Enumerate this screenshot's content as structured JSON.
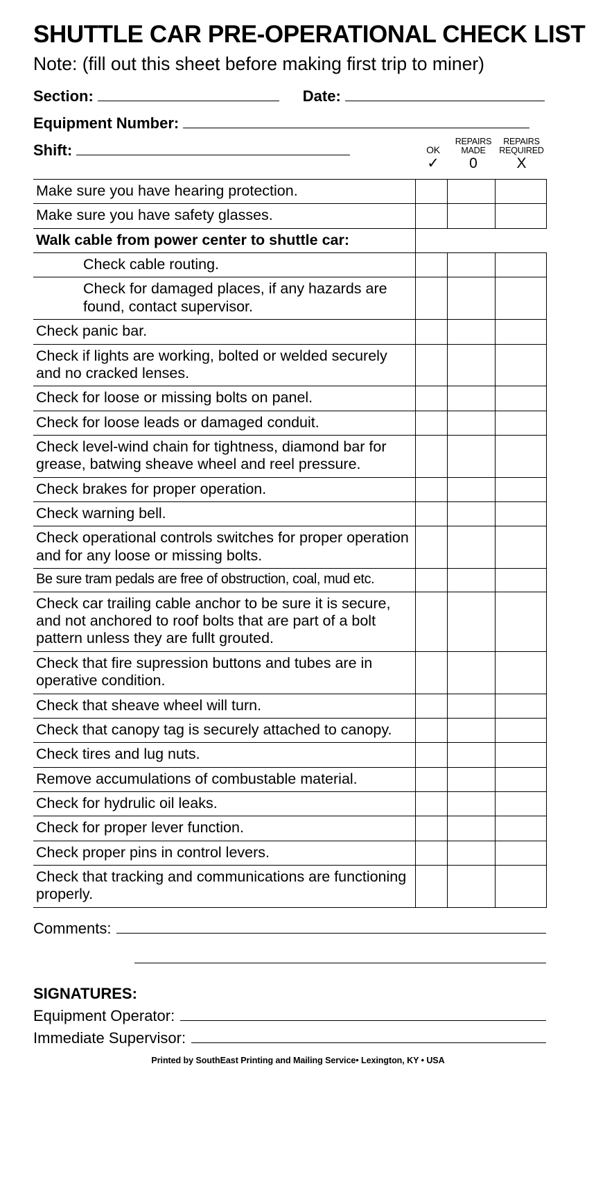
{
  "header": {
    "title": "SHUTTLE CAR PRE-OPERATIONAL CHECK LIST",
    "note": "Note: (fill out this sheet before making first trip to miner)"
  },
  "fields": {
    "section_label": "Section:",
    "date_label": "Date:",
    "equipment_number_label": "Equipment Number:",
    "shift_label": "Shift:",
    "section_value": "",
    "date_value": "",
    "equipment_number_value": "",
    "shift_value": ""
  },
  "columns": [
    {
      "key": "ok",
      "text": "OK",
      "symbol": "✓"
    },
    {
      "key": "repairs_made",
      "line1": "REPAIRS",
      "line2": "MADE",
      "symbol": "0"
    },
    {
      "key": "repairs_required",
      "line1": "REPAIRS",
      "line2": "REQUIRED",
      "symbol": "X"
    }
  ],
  "checklist": [
    {
      "text": "Make sure you have hearing protection.",
      "bold": false,
      "indent": false,
      "condensed": false
    },
    {
      "text": "Make sure you have safety glasses.",
      "bold": false,
      "indent": false,
      "condensed": false
    },
    {
      "text": "Walk cable from power center to shuttle car:",
      "bold": true,
      "indent": false,
      "condensed": false,
      "no_boxes": true
    },
    {
      "text": "Check cable routing.",
      "bold": false,
      "indent": true,
      "condensed": false
    },
    {
      "text": "Check for damaged places, if any hazards are found, contact supervisor.",
      "bold": false,
      "indent": true,
      "condensed": false
    },
    {
      "text": "Check panic bar.",
      "bold": false,
      "indent": false,
      "condensed": false
    },
    {
      "text": "Check if lights are working, bolted or welded securely and no cracked lenses.",
      "bold": false,
      "indent": false,
      "condensed": false
    },
    {
      "text": "Check for loose or missing bolts on panel.",
      "bold": false,
      "indent": false,
      "condensed": false
    },
    {
      "text": "Check for loose leads or damaged conduit.",
      "bold": false,
      "indent": false,
      "condensed": false
    },
    {
      "text": "Check level-wind chain for tightness, diamond bar for grease, batwing sheave wheel and reel pressure.",
      "bold": false,
      "indent": false,
      "condensed": false
    },
    {
      "text": "Check brakes for proper operation.",
      "bold": false,
      "indent": false,
      "condensed": false
    },
    {
      "text": "Check warning bell.",
      "bold": false,
      "indent": false,
      "condensed": false
    },
    {
      "text": "Check operational controls switches for proper operation and for any loose or missing bolts.",
      "bold": false,
      "indent": false,
      "condensed": false
    },
    {
      "text": "Be sure tram pedals are free of obstruction, coal, mud etc.",
      "bold": false,
      "indent": false,
      "condensed": true
    },
    {
      "text": "Check car trailing cable anchor to be sure it is secure, and not anchored to roof bolts that are part of a bolt pattern unless they are fullt grouted.",
      "bold": false,
      "indent": false,
      "condensed": false
    },
    {
      "text": "Check that fire supression buttons and tubes are in operative condition.",
      "bold": false,
      "indent": false,
      "condensed": false
    },
    {
      "text": "Check that sheave wheel will turn.",
      "bold": false,
      "indent": false,
      "condensed": false
    },
    {
      "text": "Check that canopy tag is securely attached to canopy.",
      "bold": false,
      "indent": false,
      "condensed": false
    },
    {
      "text": "Check tires and lug nuts.",
      "bold": false,
      "indent": false,
      "condensed": false
    },
    {
      "text": "Remove accumulations of combustable material.",
      "bold": false,
      "indent": false,
      "condensed": false
    },
    {
      "text": "Check for hydrulic oil leaks.",
      "bold": false,
      "indent": false,
      "condensed": false
    },
    {
      "text": "Check for proper lever function.",
      "bold": false,
      "indent": false,
      "condensed": false
    },
    {
      "text": "Check proper pins in control levers.",
      "bold": false,
      "indent": false,
      "condensed": false
    },
    {
      "text": "Check that tracking and communications are functioning properly.",
      "bold": false,
      "indent": false,
      "condensed": false
    }
  ],
  "comments": {
    "label": "Comments:",
    "value": ""
  },
  "signatures": {
    "title": "SIGNATURES:",
    "operator_label": "Equipment Operator:",
    "supervisor_label": "Immediate Supervisor:",
    "operator_value": "",
    "supervisor_value": ""
  },
  "footer": {
    "text": "Printed by SouthEast Printing and Mailing Service• Lexington, KY • USA"
  }
}
